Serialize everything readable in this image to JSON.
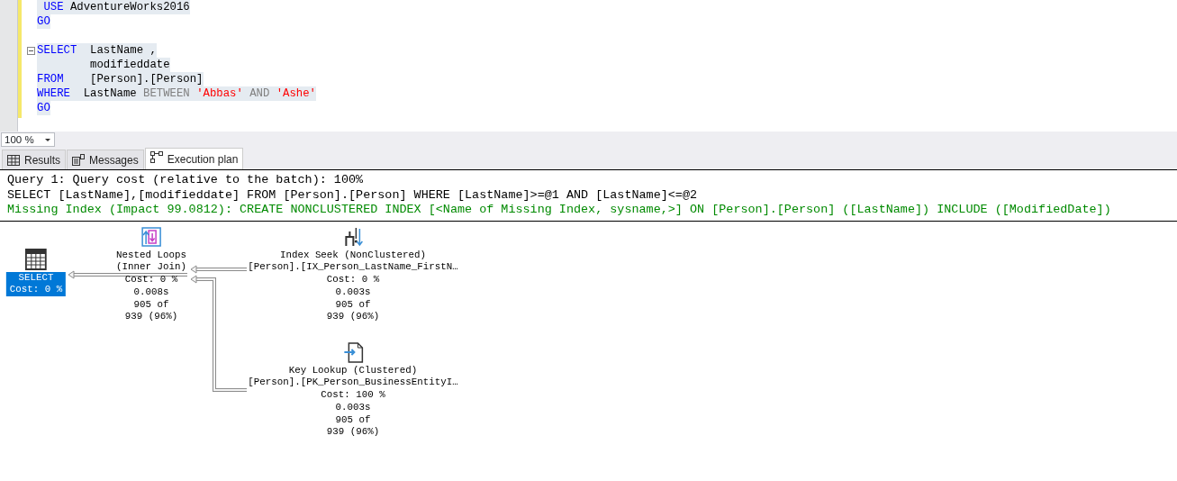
{
  "editor": {
    "lines": [
      {
        "fold": false,
        "tokens": [
          {
            "kind": "keyword",
            "text": " USE"
          },
          {
            "kind": "plain",
            "text": " AdventureWorks2016"
          }
        ]
      },
      {
        "fold": false,
        "tokens": [
          {
            "kind": "keyword",
            "text": "GO"
          }
        ]
      },
      {
        "fold": false
      },
      {
        "fold": true,
        "tokens": [
          {
            "kind": "keyword",
            "text": "SELECT"
          },
          {
            "kind": "plain",
            "text": "  LastName ,"
          }
        ]
      },
      {
        "fold": false,
        "tokens": [
          {
            "kind": "plain",
            "text": "        modifieddate"
          }
        ]
      },
      {
        "fold": false,
        "tokens": [
          {
            "kind": "keyword",
            "text": "FROM"
          },
          {
            "kind": "plain",
            "text": "    [Person].[Person]"
          }
        ]
      },
      {
        "fold": false,
        "tokens": [
          {
            "kind": "keyword",
            "text": "WHERE"
          },
          {
            "kind": "plain",
            "text": "  LastName "
          },
          {
            "kind": "operator",
            "text": "BETWEEN "
          },
          {
            "kind": "string",
            "text": "'Abbas'"
          },
          {
            "kind": "operator",
            "text": " AND "
          },
          {
            "kind": "string",
            "text": "'Ashe'"
          }
        ]
      },
      {
        "fold": false,
        "tokens": [
          {
            "kind": "keyword",
            "text": "GO"
          }
        ]
      }
    ]
  },
  "zoom": {
    "value": "100 %"
  },
  "tabs": [
    {
      "label": "Results",
      "kind": "grid",
      "selected": false
    },
    {
      "label": "Messages",
      "kind": "messages",
      "selected": false
    },
    {
      "label": "Execution plan",
      "kind": "plan",
      "selected": true
    }
  ],
  "plan": {
    "header": [
      {
        "kind": "info",
        "text": "Query 1: Query cost (relative to the batch): 100%"
      },
      {
        "kind": "info",
        "text": "SELECT [LastName],[modifieddate] FROM [Person].[Person] WHERE [LastName]>=@1 AND [LastName]<=@2"
      },
      {
        "kind": "missing",
        "text": "Missing Index (Impact 99.0812): CREATE NONCLUSTERED INDEX [<Name of Missing Index, sysname,>] ON [Person].[Person] ([LastName]) INCLUDE ([ModifiedDate])"
      }
    ],
    "nodes": [
      {
        "kind": "select",
        "selected": true,
        "lines": [
          "SELECT",
          "Cost: 0 %"
        ]
      },
      {
        "kind": "nested_loops",
        "selected": false,
        "lines": [
          "Nested Loops",
          "(Inner Join)",
          "Cost: 0 %",
          "0.008s",
          "905 of",
          "939 (96%)"
        ]
      },
      {
        "kind": "index_seek",
        "selected": false,
        "lines": [
          "Index Seek (NonClustered)",
          "[Person].[IX_Person_LastName_FirstN…",
          "Cost: 0 %",
          "0.003s",
          "905 of",
          "939 (96%)"
        ]
      },
      {
        "kind": "key_lookup",
        "selected": false,
        "lines": [
          "Key Lookup (Clustered)",
          "[Person].[PK_Person_BusinessEntityI…",
          "Cost: 100 %",
          "0.003s",
          "905 of",
          "939 (96%)"
        ]
      }
    ]
  }
}
